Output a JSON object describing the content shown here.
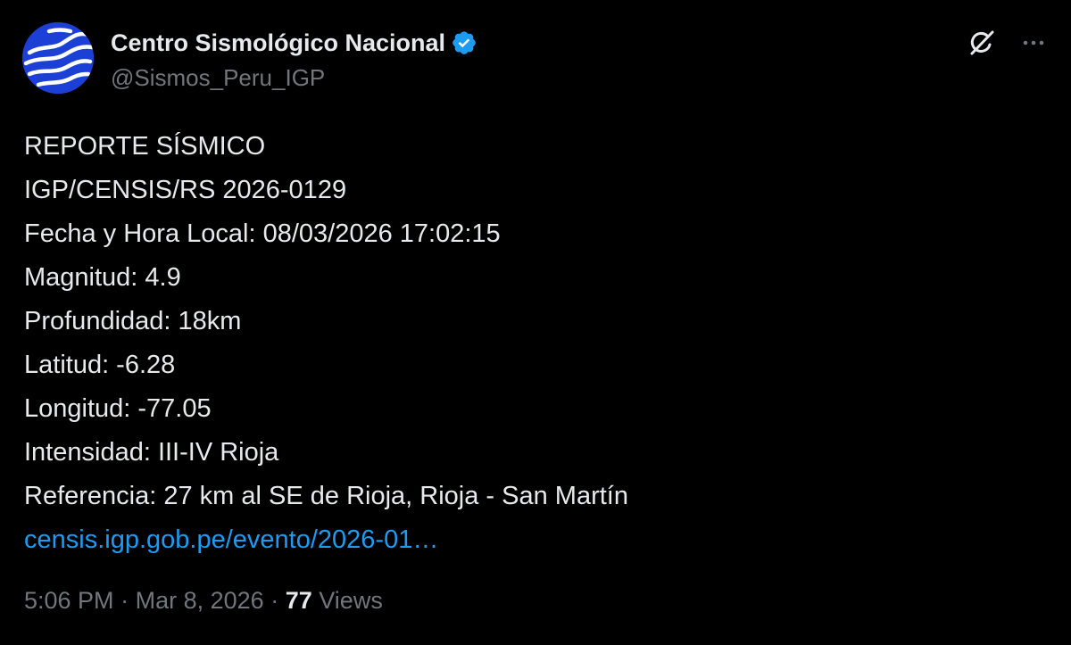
{
  "author": {
    "display_name": "Centro Sismológico Nacional",
    "handle": "@Sismos_Peru_IGP",
    "verified": true,
    "avatar_icon": "igp-waves-logo",
    "avatar_color": "#1c3fd6"
  },
  "header_actions": {
    "grok_icon": "grok-icon",
    "more_icon": "more-options-icon"
  },
  "post": {
    "lines": [
      "REPORTE SÍSMICO",
      "IGP/CENSIS/RS 2026-0129",
      "Fecha y Hora Local: 08/03/2026 17:02:15",
      "Magnitud: 4.9",
      "Profundidad: 18km",
      "Latitud: -6.28",
      "Longitud: -77.05",
      "Intensidad: III-IV Rioja",
      "Referencia: 27 km al SE de Rioja, Rioja - San Martín"
    ],
    "link_text": "censis.igp.gob.pe/evento/2026-01…"
  },
  "meta": {
    "time": "5:06 PM",
    "separator": "·",
    "date": "Mar 8, 2026",
    "views_count": "77",
    "views_label": "Views"
  },
  "colors": {
    "background": "#000000",
    "text": "#e7e9ea",
    "secondary": "#71767b",
    "link": "#1d9bf0",
    "verified": "#1d9bf0"
  }
}
